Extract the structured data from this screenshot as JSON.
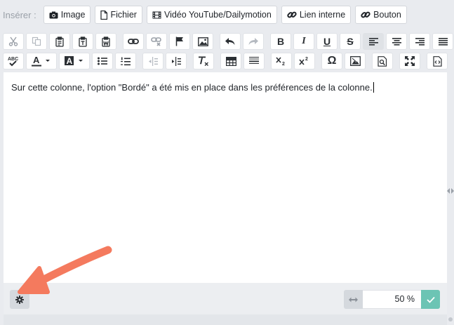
{
  "insert_bar": {
    "label": "Insérer :",
    "buttons": [
      {
        "label": "Image",
        "icon": "camera-icon"
      },
      {
        "label": "Fichier",
        "icon": "file-icon"
      },
      {
        "label": "Vidéo YouTube/Dailymotion",
        "icon": "film-icon"
      },
      {
        "label": "Lien interne",
        "icon": "link-icon"
      },
      {
        "label": "Bouton",
        "icon": "link-icon"
      }
    ]
  },
  "toolbar": {
    "row1": [
      "cut-icon",
      "copy-icon",
      "paste-icon",
      "paste-text-icon",
      "paste-word-icon",
      "link-icon",
      "unlink-icon",
      "anchor-flag-icon",
      "image-icon",
      "undo-icon",
      "redo-icon",
      "bold-icon",
      "italic-icon",
      "underline-icon",
      "strikethrough-icon",
      "align-left-icon",
      "align-center-icon",
      "align-right-icon",
      "justify-icon"
    ],
    "row2": [
      "spellcheck-icon",
      "text-color-icon",
      "background-color-icon",
      "bulleted-list-icon",
      "numbered-list-icon",
      "outdent-icon",
      "indent-icon",
      "remove-format-icon",
      "table-icon",
      "horizontal-rule-icon",
      "subscript-icon",
      "superscript-icon",
      "special-char-icon",
      "iframe-icon",
      "preview-icon",
      "maximize-icon",
      "source-icon"
    ],
    "labels": {
      "bold": "B",
      "italic": "I",
      "underline": "U",
      "strike": "S",
      "spell": "ABC",
      "omega": "Ω",
      "textcolor": "A",
      "bgcolor": "A"
    }
  },
  "editor": {
    "content": "Sur cette colonne, l'option \"Bordé\" a été mis en place dans les préférences de la colonne."
  },
  "footer": {
    "width_value": "50 %",
    "settings_icon": "gear-icon",
    "width_icon": "horizontal-resize-icon",
    "confirm_icon": "check-icon"
  },
  "colors": {
    "accent": "#6cc4b4",
    "arrow": "#f47a5e",
    "background": "#e9ebef"
  }
}
